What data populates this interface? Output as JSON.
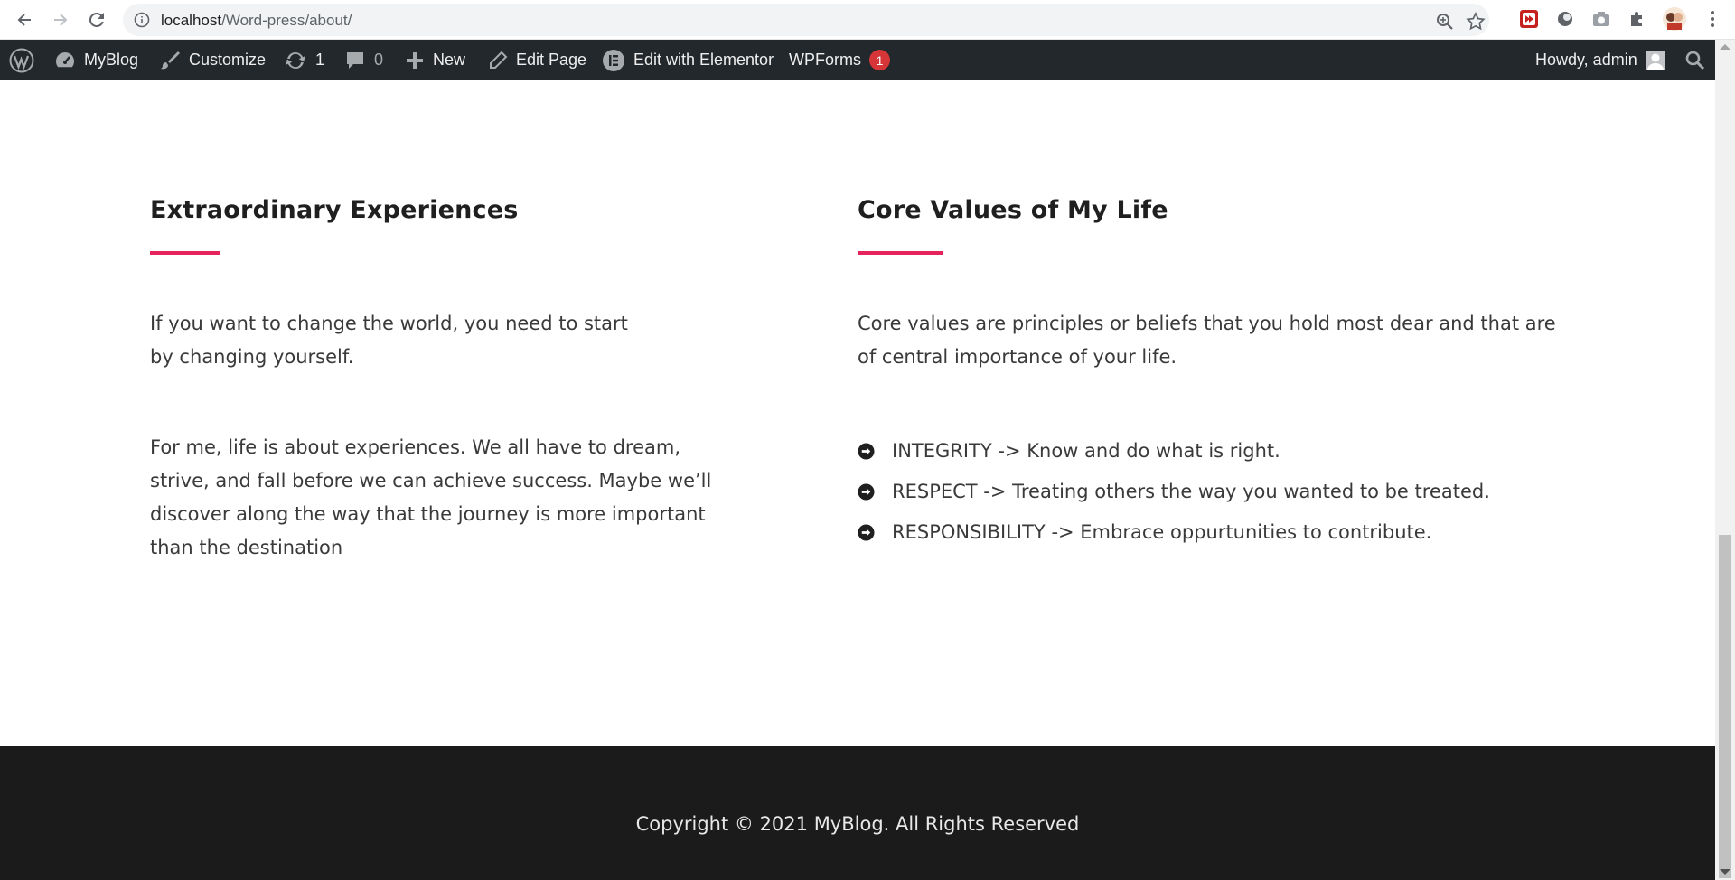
{
  "browser": {
    "url_host": "localhost",
    "url_path": "/Word-press/about/"
  },
  "adminbar": {
    "site_name": "MyBlog",
    "customize": "Customize",
    "updates_count": "1",
    "comments_count": "0",
    "new": "New",
    "edit_page": "Edit Page",
    "elementor": "Edit with Elementor",
    "wpforms": "WPForms",
    "wpforms_badge": "1",
    "howdy": "Howdy, admin"
  },
  "left_column": {
    "heading": "Extraordinary Experiences",
    "paragraph1": "If you want to change the world, you need to start by changing yourself.",
    "paragraph2": "For me, life is about experiences. We all have to dream, strive, and fall before we can achieve success. Maybe we’ll discover along the way that the journey is more important than the destination"
  },
  "right_column": {
    "heading": "Core Values of My Life",
    "paragraph": "Core values are principles or beliefs that you hold most dear and that are of central importance of your life.",
    "values": [
      "INTEGRITY -> Know and do what is right.",
      "RESPECT -> Treating others the way you wanted to be treated.",
      "RESPONSIBILITY -> Embrace oppurtunities to contribute."
    ]
  },
  "footer": {
    "copyright": "Copyright © 2021 MyBlog. All Rights Reserved"
  },
  "colors": {
    "accent": "#e6245c",
    "adminbar_bg": "#23282d",
    "footer_bg": "#1b1b1b",
    "badge": "#d63638"
  }
}
